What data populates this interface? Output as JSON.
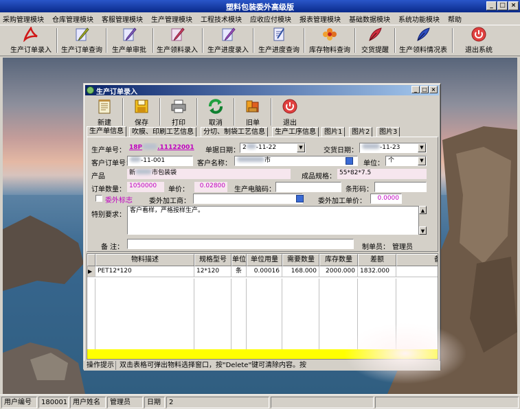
{
  "window": {
    "title": "塑料包装委外高级版",
    "controls": [
      "_",
      "□",
      "×"
    ]
  },
  "menu": [
    "采购管理模块",
    "仓库管理模块",
    "客服管理模块",
    "生产管理模块",
    "工程技术模块",
    "应收应付模块",
    "报表管理模块",
    "基础数据模块",
    "系统功能模块",
    "帮助"
  ],
  "toolbar": [
    {
      "label": "生产订单录入",
      "icon": "pdf-icon"
    },
    {
      "label": "生产订单查询",
      "icon": "pen-icon"
    },
    {
      "label": "生产单审批",
      "icon": "pen-icon"
    },
    {
      "label": "生产领料录入",
      "icon": "pen-icon"
    },
    {
      "label": "生产进度录入",
      "icon": "pen-icon"
    },
    {
      "label": "生产进度查询",
      "icon": "document-icon"
    },
    {
      "label": "库存物料查询",
      "icon": "flower-icon"
    },
    {
      "label": "交货提醒",
      "icon": "quill-icon"
    },
    {
      "label": "生产领料情况表",
      "icon": "quill-icon"
    },
    {
      "label": "退出系统",
      "icon": "power-icon"
    }
  ],
  "dialog": {
    "title": "生产订单录入",
    "toolbar": [
      {
        "label": "新建",
        "icon": "notepad-icon"
      },
      {
        "label": "保存",
        "icon": "floppy-icon"
      },
      {
        "label": "打印",
        "icon": "printer-icon"
      },
      {
        "label": "取消",
        "icon": "refresh-icon"
      },
      {
        "label": "旧单",
        "icon": "books-icon"
      },
      {
        "label": "退出",
        "icon": "power-icon"
      }
    ],
    "tabs": [
      "生产单信息",
      "吹膜、印刷工艺信息",
      "分切、制袋工艺信息",
      "生产工序信息",
      "图片1",
      "图片2",
      "图片3"
    ],
    "form": {
      "order_no_label": "生产单号：",
      "order_no_value": "18P",
      "order_no_value2": ".11122001",
      "doc_date_label": "单据日期：",
      "doc_date_value": "2",
      "doc_date_value2": "-11-22",
      "delivery_date_label": "交货日期：",
      "delivery_date_value": "",
      "delivery_date_value2": "-11-23",
      "cust_order_label": "客户订单号：",
      "cust_order_value": "-11-001",
      "cust_name_label": "客户名称：",
      "cust_name_value": "",
      "cust_name_value2": "市",
      "unit_label": "单位：",
      "unit_value": "个",
      "product_label": "产品",
      "product_value": "新",
      "product_value2": "市包装袋",
      "spec_label": "成品规格：",
      "spec_value": "55*82*7.5",
      "qty_label": "订单数量：",
      "qty_value": "1050000",
      "price_label": "单价：",
      "price_value": "0.02800",
      "plate_label": "生产电脑码：",
      "plate_value": "",
      "barcode_label": "条形码：",
      "barcode_value": "",
      "outsource_flag_label": "委外标志",
      "outsource_vendor_label": "委外加工商：",
      "outsource_vendor_value": "",
      "outsource_price_label": "委外加工单价：",
      "outsource_price_value": "0.0000",
      "special_req_label": "特别要求：",
      "special_req_value": "客户看样，严格按样生产。",
      "remark_label": "备  注：",
      "remark_value": "",
      "creator_label": "制单员：",
      "creator_value": "管理员"
    },
    "grid": {
      "columns": [
        "物料描述",
        "规格型号",
        "单位",
        "单位用量",
        "需要数量",
        "库存数量",
        "差额",
        "备"
      ],
      "rows": [
        [
          "PET12*120",
          "12*120",
          "条",
          "0.00016",
          "168.000",
          "2000.000",
          "1832.000",
          ""
        ]
      ]
    },
    "hint_label": "操作提示",
    "hint_text": "双击表格可弹出物料选择窗口，按\"Delete\"键可清除内容。按"
  },
  "statusbar": {
    "user_id_label": "用户编号",
    "user_id_value": "180001",
    "user_name_label": "用户姓名",
    "user_name_value": "管理员",
    "date_label": "日期",
    "date_value": "2"
  }
}
